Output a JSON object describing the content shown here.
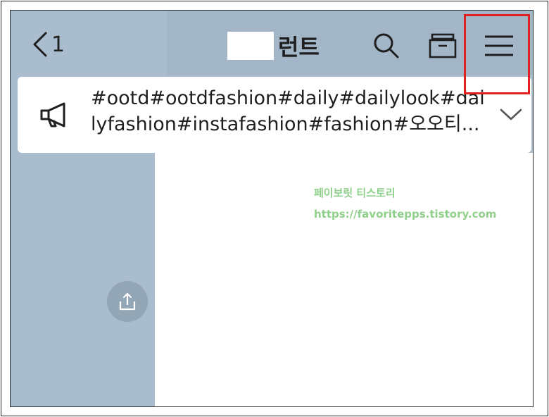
{
  "header": {
    "back_count": "1",
    "title_suffix": "런트",
    "icons": {
      "back": "chevron-left-icon",
      "search": "search-icon",
      "archive": "drawer-icon",
      "menu": "hamburger-menu-icon"
    }
  },
  "notice": {
    "icon": "megaphone-icon",
    "text": "#ootd#ootdfashion#daily#dailylook#dailyfashion#instafashion#fashion#오오티...",
    "expand_icon": "chevron-down-icon"
  },
  "watermark": {
    "line1": "페이보릿 티스토리",
    "line2": "https://favoritepps.tistory.com"
  },
  "share": {
    "icon": "share-icon"
  },
  "colors": {
    "background": "#a9bdce",
    "highlight": "#e2201f",
    "watermark": "#8fd08a",
    "share_button": "#93a6b6"
  }
}
